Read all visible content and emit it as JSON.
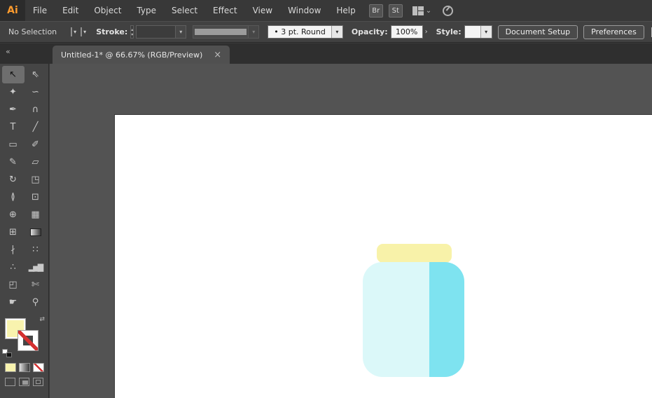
{
  "app": {
    "logo": "Ai"
  },
  "menubar": {
    "items": [
      "File",
      "Edit",
      "Object",
      "Type",
      "Select",
      "Effect",
      "View",
      "Window",
      "Help"
    ],
    "bridge_button": "Br",
    "stock_button": "St"
  },
  "controlbar": {
    "selection_status": "No Selection",
    "stroke_label": "Stroke:",
    "brush_value": "•  3 pt. Round",
    "opacity_label": "Opacity:",
    "opacity_value": "100%",
    "style_label": "Style:",
    "document_setup_button": "Document Setup",
    "preferences_button": "Preferences"
  },
  "tabbar": {
    "collapse_chevrons": "«",
    "tab_title": "Untitled-1* @ 66.67% (RGB/Preview)",
    "close": "×"
  },
  "toolbar": {
    "tools": [
      {
        "name": "selection-tool",
        "glyph": "↖",
        "selected": true
      },
      {
        "name": "direct-selection-tool",
        "glyph": "⇖"
      },
      {
        "name": "magic-wand-tool",
        "glyph": "✦"
      },
      {
        "name": "lasso-tool",
        "glyph": "∽"
      },
      {
        "name": "pen-tool",
        "glyph": "✒"
      },
      {
        "name": "curvature-tool",
        "glyph": "∩"
      },
      {
        "name": "type-tool",
        "glyph": "T"
      },
      {
        "name": "line-segment-tool",
        "glyph": "╱"
      },
      {
        "name": "rectangle-tool",
        "glyph": "▭"
      },
      {
        "name": "paintbrush-tool",
        "glyph": "✐"
      },
      {
        "name": "shaper-tool",
        "glyph": "✎"
      },
      {
        "name": "eraser-tool",
        "glyph": "▱"
      },
      {
        "name": "rotate-tool",
        "glyph": "↻"
      },
      {
        "name": "scale-tool",
        "glyph": "◳"
      },
      {
        "name": "width-tool",
        "glyph": "≬"
      },
      {
        "name": "free-transform-tool",
        "glyph": "⊡"
      },
      {
        "name": "shape-builder-tool",
        "glyph": "⊕"
      },
      {
        "name": "perspective-grid-tool",
        "glyph": "▦"
      },
      {
        "name": "mesh-tool",
        "glyph": "⊞"
      },
      {
        "name": "gradient-tool",
        "glyph": ""
      },
      {
        "name": "eyedropper-tool",
        "glyph": "∤"
      },
      {
        "name": "blend-tool",
        "glyph": "∷"
      },
      {
        "name": "symbol-sprayer-tool",
        "glyph": "∴"
      },
      {
        "name": "column-graph-tool",
        "glyph": "▂▅▇"
      },
      {
        "name": "artboard-tool",
        "glyph": "◰"
      },
      {
        "name": "slice-tool",
        "glyph": "✄"
      },
      {
        "name": "hand-tool",
        "glyph": "☛"
      },
      {
        "name": "zoom-tool",
        "glyph": "⚲"
      }
    ]
  },
  "glyphs": {
    "dropdown": "▾",
    "stepper_up": "▴",
    "stepper_down": "▾",
    "workspace_chevron": "⌄",
    "menu_chevron": "›",
    "swap": "⇄"
  },
  "colors": {
    "logo_orange": "#FF9C2E",
    "fill_swatch": "#F8F3AE",
    "jar_lid": "#F8F2A9",
    "jar_body": "#DBF8F9",
    "jar_body_shade": "#7EE3F0",
    "artboard": "#FFFFFF"
  }
}
